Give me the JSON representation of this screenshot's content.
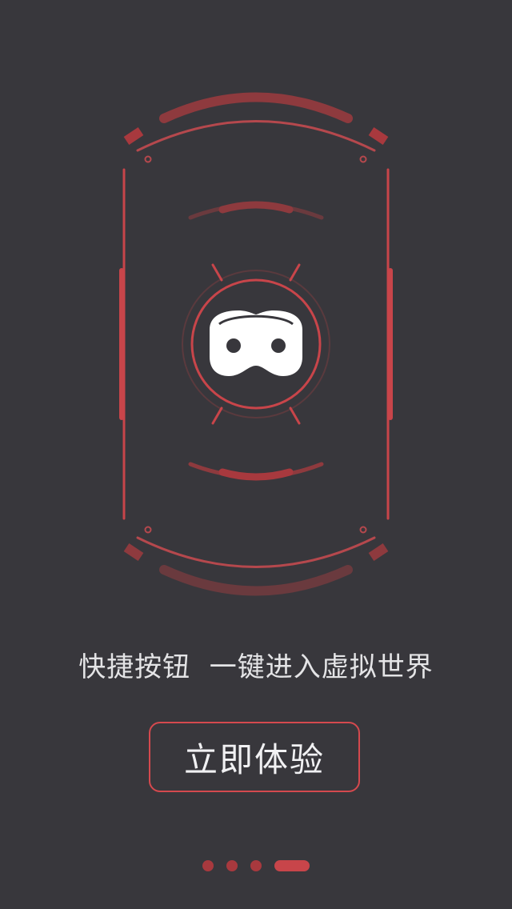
{
  "colors": {
    "background": "#38373c",
    "accent": "#d5494e",
    "accent_dark": "#8e3a3e",
    "icon": "#ffffff",
    "text": "#e4e4e6"
  },
  "illustration": {
    "icon": "vr-headset-icon"
  },
  "tagline": "快捷按钮  一键进入虚拟世界",
  "cta": {
    "label": "立即体验"
  },
  "pager": {
    "total": 4,
    "active_index": 3
  }
}
